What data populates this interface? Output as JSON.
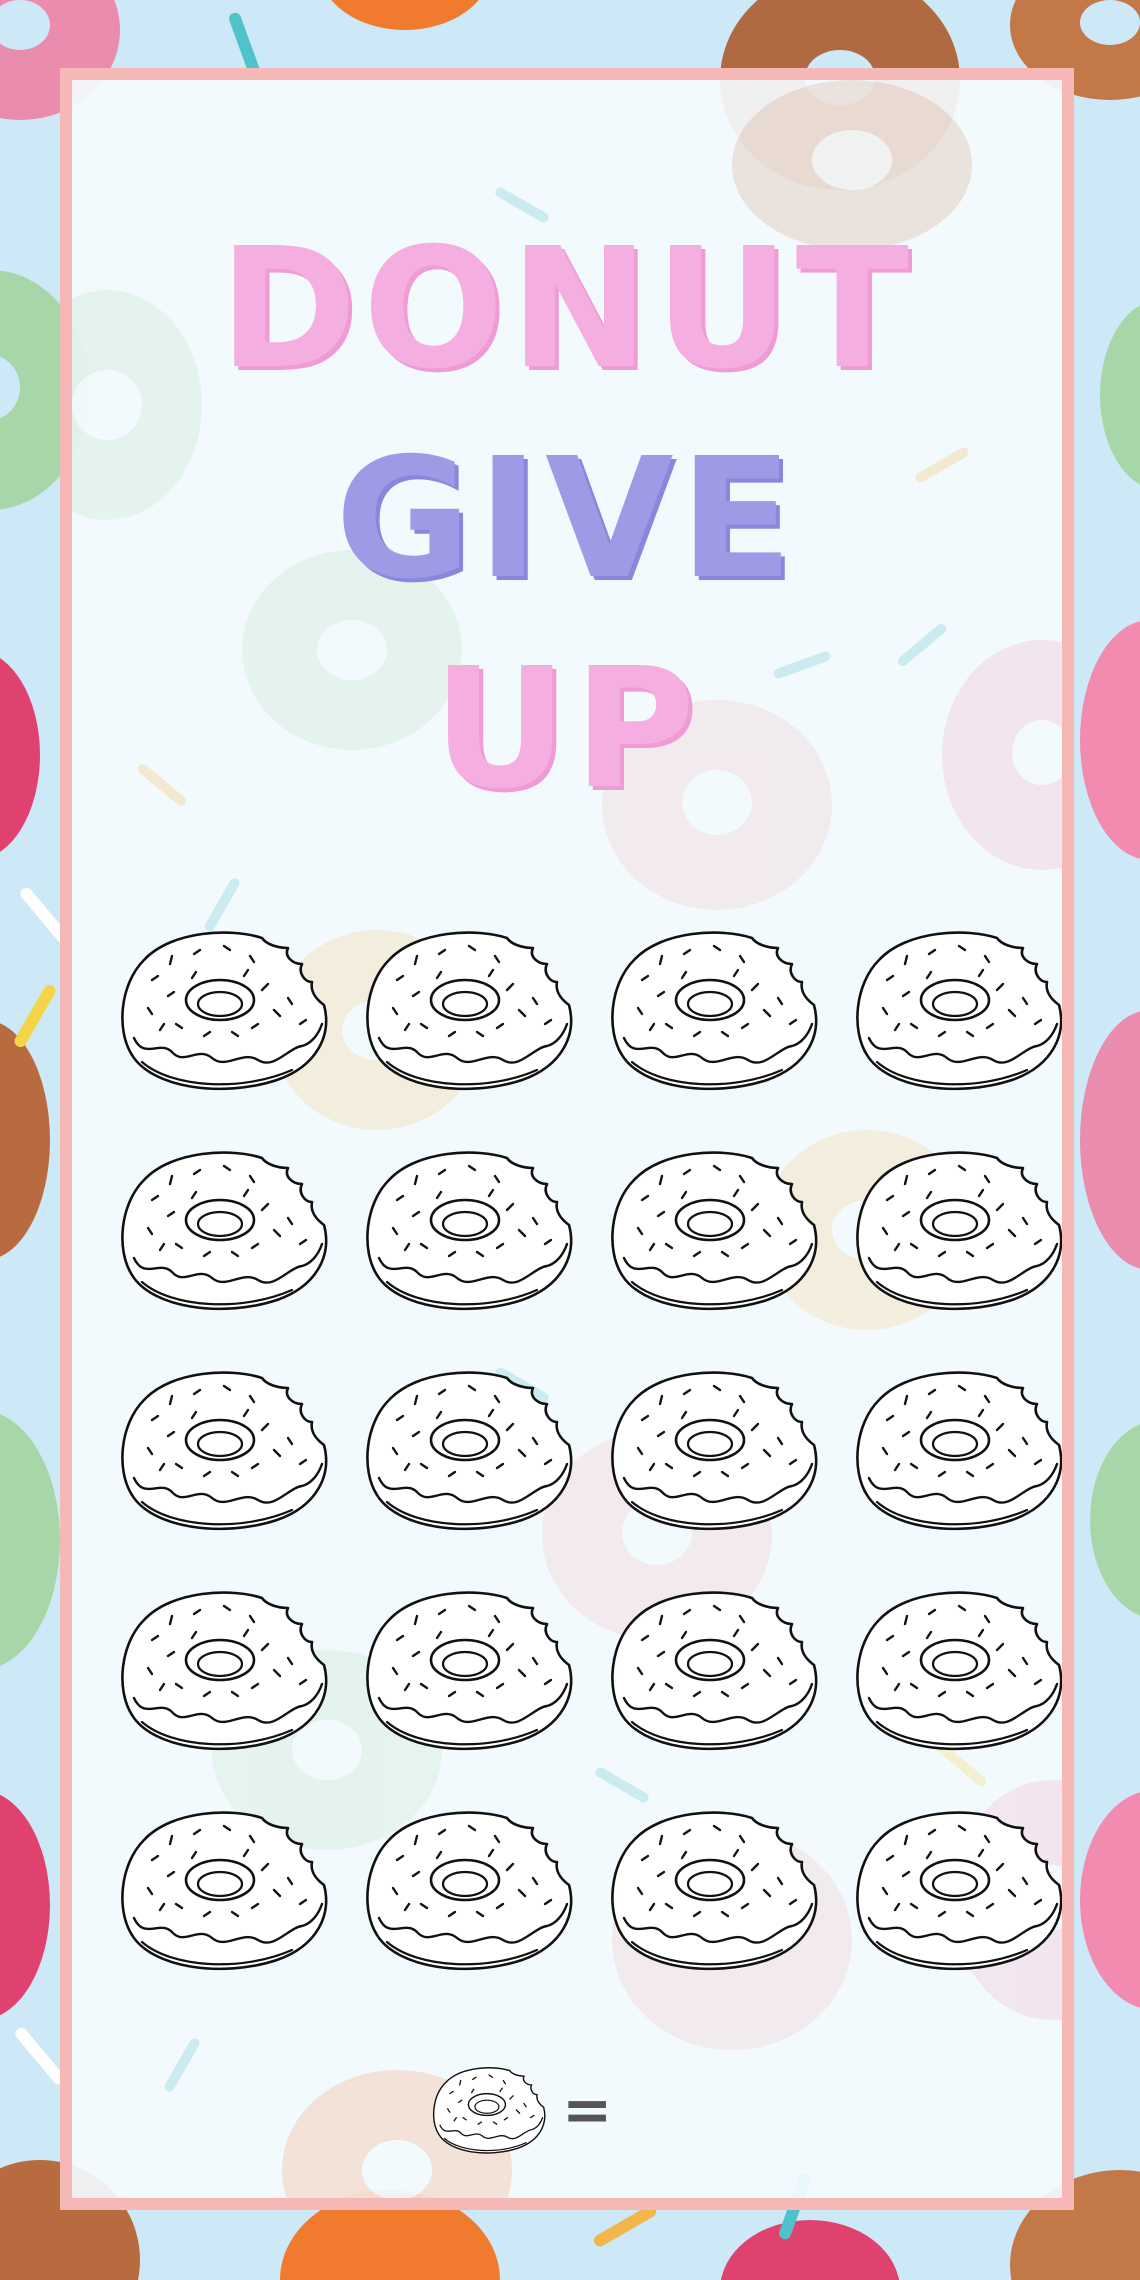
{
  "title": {
    "line1": "DONUT",
    "line2": "GIVE",
    "line3": "UP"
  },
  "tracker": {
    "rows": 5,
    "columns": 4,
    "icon": "bitten-donut-outline-icon"
  },
  "legend": {
    "icon": "bitten-donut-outline-icon",
    "symbol": "=",
    "value": ""
  },
  "colors": {
    "background": "#cde9f7",
    "card": "#f5fbfe",
    "border": "#f5b8b7",
    "title_pink": "#f5aee0",
    "title_purple": "#9d9ae6"
  }
}
